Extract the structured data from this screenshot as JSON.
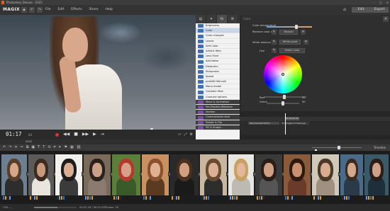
{
  "title_bar": {
    "title": "Photostory Deluxe - 2022",
    "controls": [
      "–",
      "□",
      "✕"
    ]
  },
  "brand": {
    "logo": "MAGIX"
  },
  "menu": {
    "items": [
      "File",
      "Edit",
      "Effects",
      "Share",
      "Help"
    ]
  },
  "modes": {
    "edit": "Edit",
    "export": "Export"
  },
  "preview": {
    "timecode": "01:17",
    "timecode_frames": "03",
    "controls": [
      "◀◀",
      "■",
      "▶▶",
      "▶",
      "⇥"
    ]
  },
  "effects_tabs": [
    "▤",
    "✦",
    "fx",
    "⚙"
  ],
  "effects_list": [
    "Brightness",
    "Color",
    "Color changes",
    "Levels",
    "Soft Color",
    "Artistic filter",
    "Lens Flare",
    "Add Noise",
    "Distortion",
    "Sharpness",
    "Speed",
    "proDAD Mercalli",
    "Mono model",
    "Gradient filter",
    "Carousel options",
    "Move & Animation",
    "Pan/Position/Rotation",
    "Section",
    "Camera/zoom shot",
    "Rotate & Flip",
    "3D & Shape..."
  ],
  "color_panel": {
    "header": "Color",
    "temperature_label": "Color temperature",
    "remove_cast_label": "Remove color cast",
    "remove_cast_button": "Manuel",
    "white_balance_label": "White balance",
    "white_point_button": "White point",
    "hue_label": "Hue",
    "select_color_button": "Select color",
    "red_label": "Red",
    "green_label": "Green",
    "red_value": "50",
    "green_value": "50"
  },
  "mini_timeline": {
    "marker": "00:00:04:20",
    "clip_name": "Start element.frame",
    "clip2_name": "6 • Angelina Flower.jpg"
  },
  "storyboard": {
    "name": "2022",
    "timeline_label": "Timeline"
  },
  "status": {
    "cpu": "CPU: —",
    "info": "00:02:16 / 06:31:00",
    "info2": "Photos: 29"
  },
  "colors": {
    "accent": "#3d6fb5",
    "selected": "#c9d6ea",
    "panel": "#2f2f2f"
  }
}
